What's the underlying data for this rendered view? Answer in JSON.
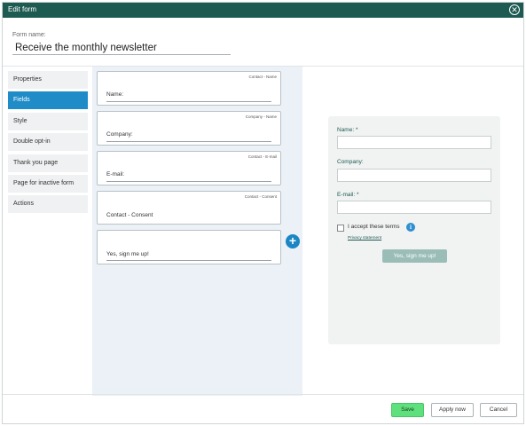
{
  "dialog": {
    "title": "Edit form",
    "close_icon": "close-icon"
  },
  "form_name": {
    "label": "Form name:",
    "value": "Receive the monthly newsletter"
  },
  "sidebar": {
    "items": [
      {
        "label": "Properties",
        "active": false
      },
      {
        "label": "Fields",
        "active": true
      },
      {
        "label": "Style",
        "active": false
      },
      {
        "label": "Double opt-in",
        "active": false
      },
      {
        "label": "Thank you page",
        "active": false
      },
      {
        "label": "Page for inactive form",
        "active": false
      },
      {
        "label": "Actions",
        "active": false
      }
    ]
  },
  "fields": [
    {
      "tag": "Contact - Name",
      "label": "Name:"
    },
    {
      "tag": "Company - Name",
      "label": "Company:"
    },
    {
      "tag": "Contact - E-mail",
      "label": "E-mail:"
    },
    {
      "tag": "Contact - Consent",
      "label": "Contact - Consent"
    },
    {
      "tag": "",
      "label": "Yes, sign me up!"
    }
  ],
  "add_button": {
    "icon": "plus-icon",
    "label": "+"
  },
  "preview": {
    "name_label": "Name: *",
    "company_label": "Company:",
    "email_label": "E-mail: *",
    "terms_label": "I accept these terms",
    "info_icon": "i",
    "privacy_link": "Privacy statement",
    "submit_label": "Yes, sign me up!"
  },
  "footer": {
    "save": "Save",
    "apply": "Apply now",
    "cancel": "Cancel"
  },
  "colors": {
    "titlebar": "#1d5b52",
    "active_nav": "#1f8cc7",
    "save": "#5ee07d",
    "submit": "#9bbdb7"
  }
}
